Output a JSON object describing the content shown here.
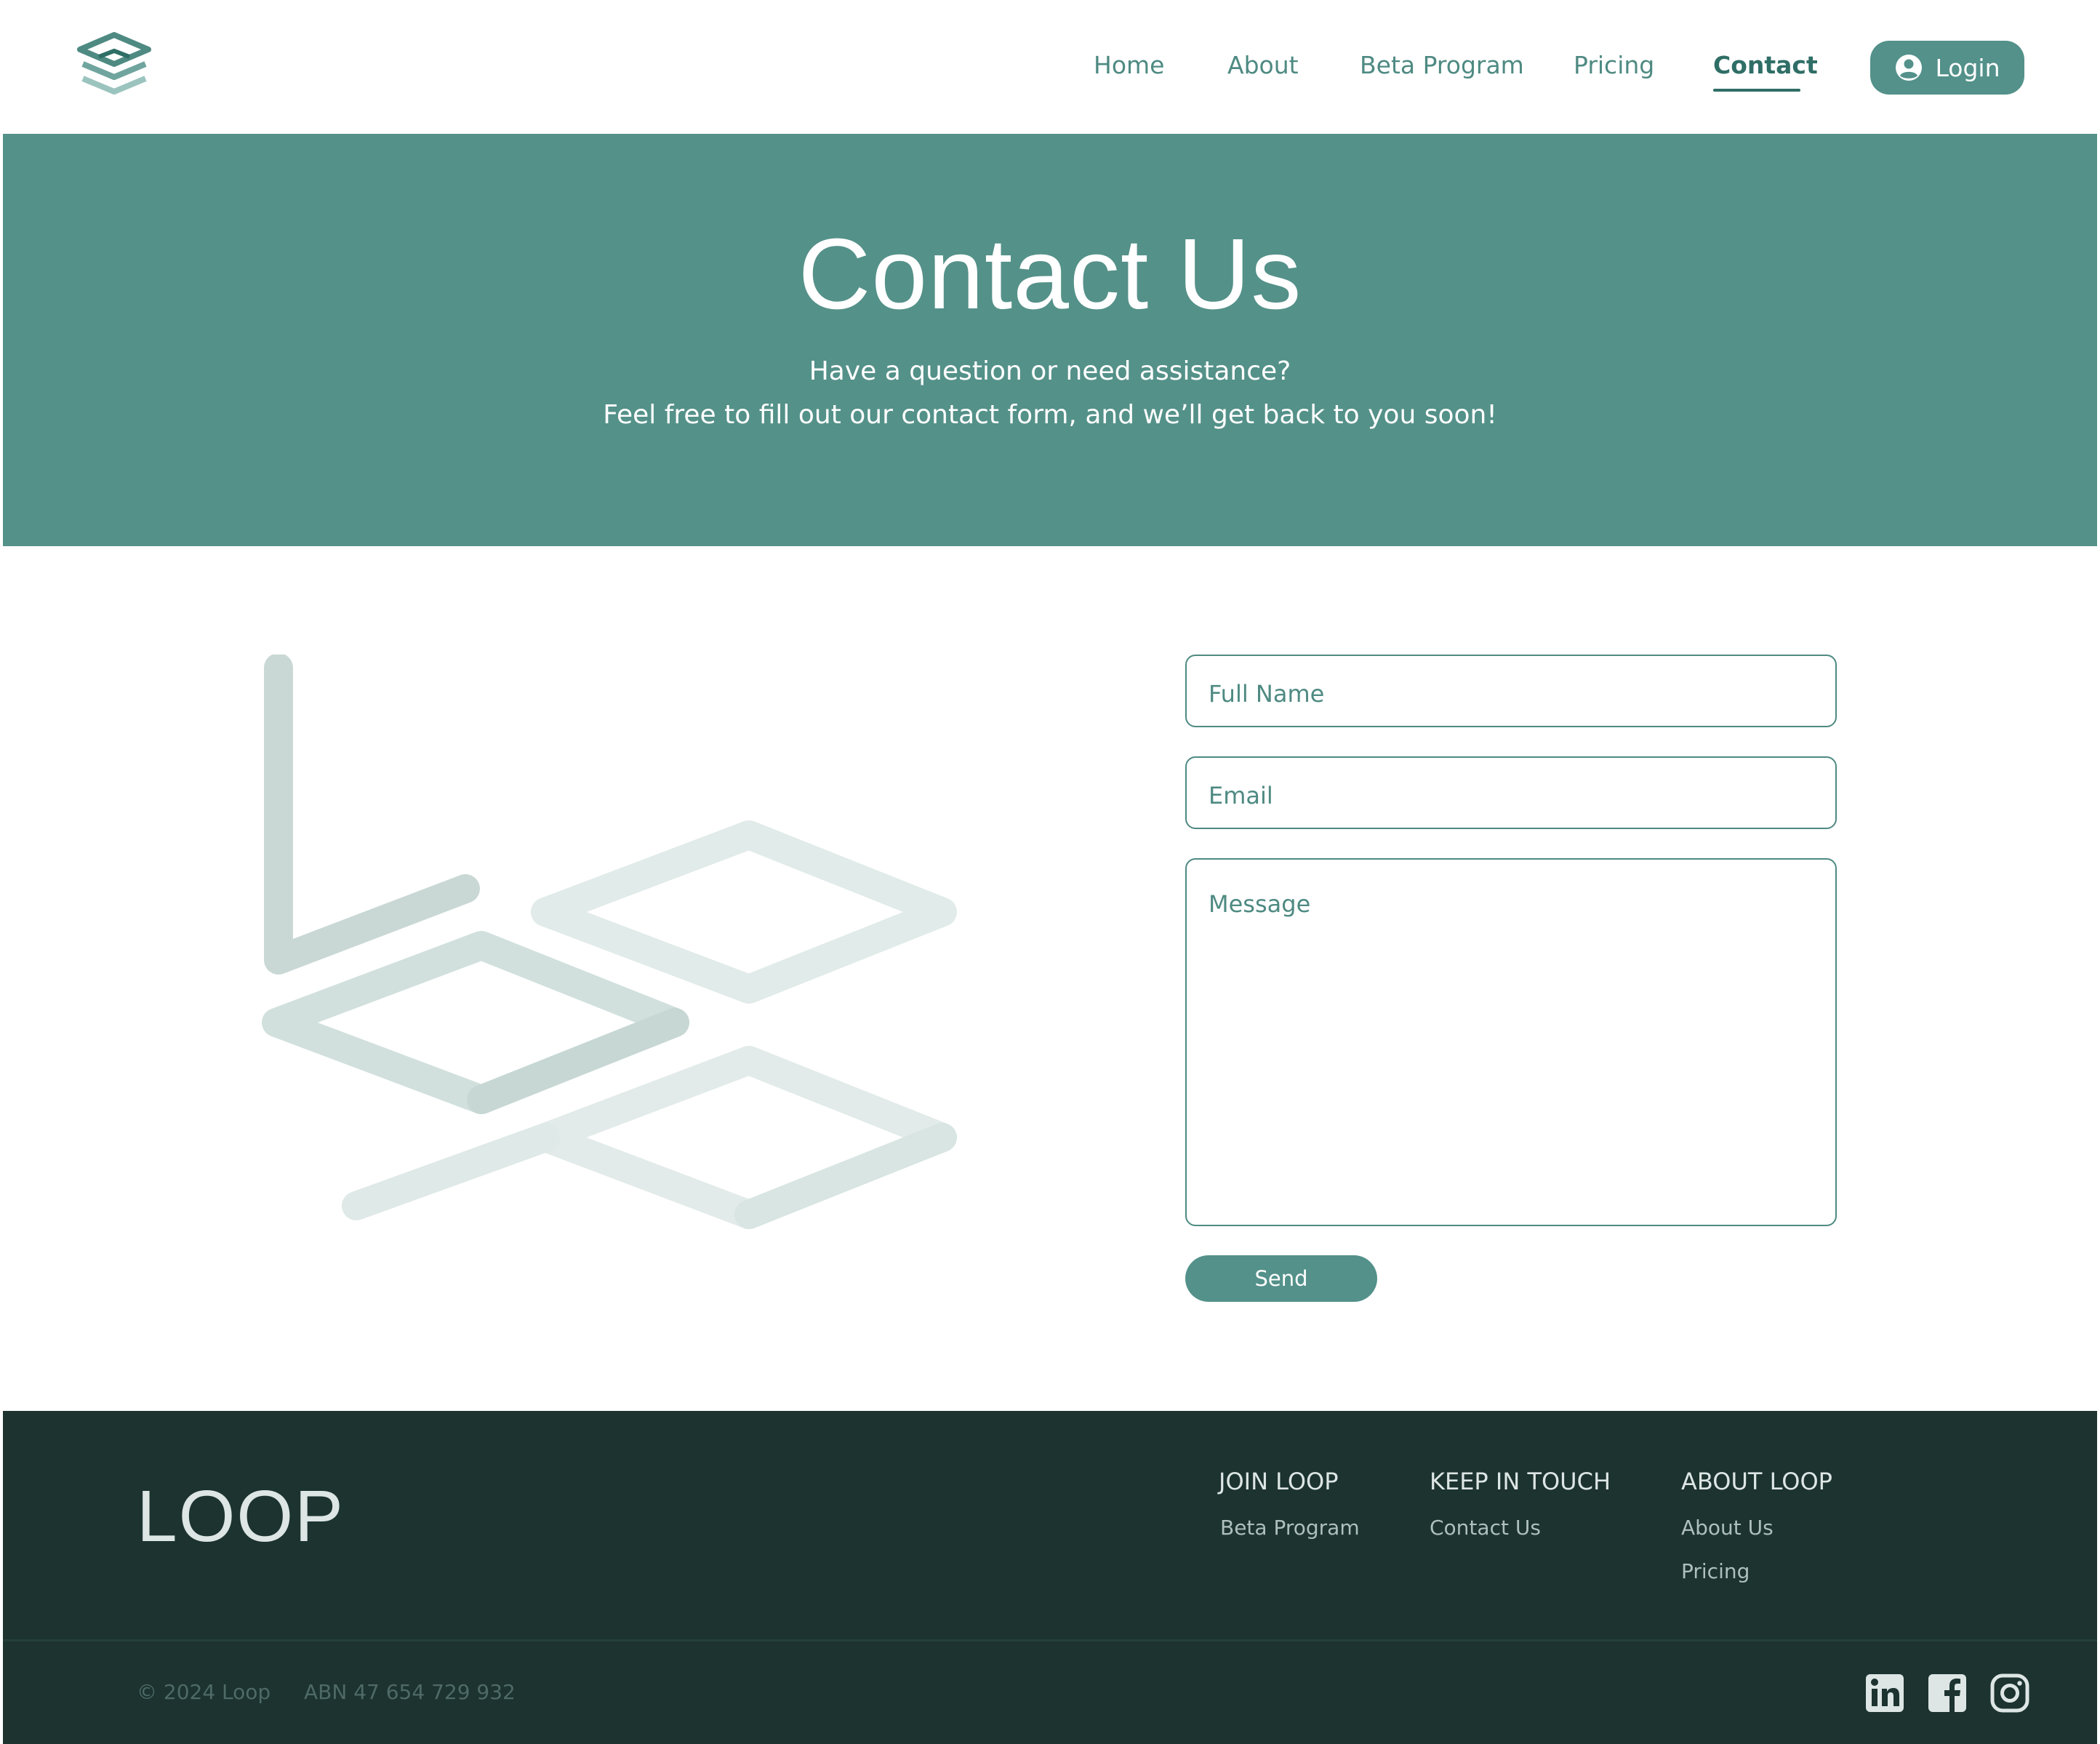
{
  "header": {
    "logo_icon": "layered-stack-logo-icon",
    "nav": [
      "Home",
      "About",
      "Beta Program",
      "Pricing",
      "Contact"
    ],
    "active_nav": "Contact",
    "login_label": "Login",
    "login_icon": "user-circle-icon"
  },
  "hero": {
    "title": "Contact Us",
    "subtitle_line1": "Have a question or need assistance?",
    "subtitle_line2": "Feel free to fill out our contact form, and we’ll get back to you soon!"
  },
  "form": {
    "full_name_placeholder": "Full Name",
    "email_placeholder": "Email",
    "message_placeholder": "Message",
    "send_label": "Send"
  },
  "footer": {
    "brand": "LOOP",
    "columns": [
      {
        "heading": "JOIN LOOP",
        "links": [
          "Beta Program"
        ]
      },
      {
        "heading": "KEEP IN TOUCH",
        "links": [
          "Contact Us"
        ]
      },
      {
        "heading": "ABOUT LOOP",
        "links": [
          "About Us",
          "Pricing"
        ]
      }
    ],
    "copyright": "© 2024 Loop",
    "abn": "ABN 47 654 729 932",
    "social_icons": [
      "linkedin-icon",
      "facebook-icon",
      "instagram-icon"
    ]
  },
  "colors": {
    "brand_teal": "#549189",
    "text_teal": "#4e8a82",
    "footer_dark": "#1c3330",
    "white": "#ffffff"
  }
}
